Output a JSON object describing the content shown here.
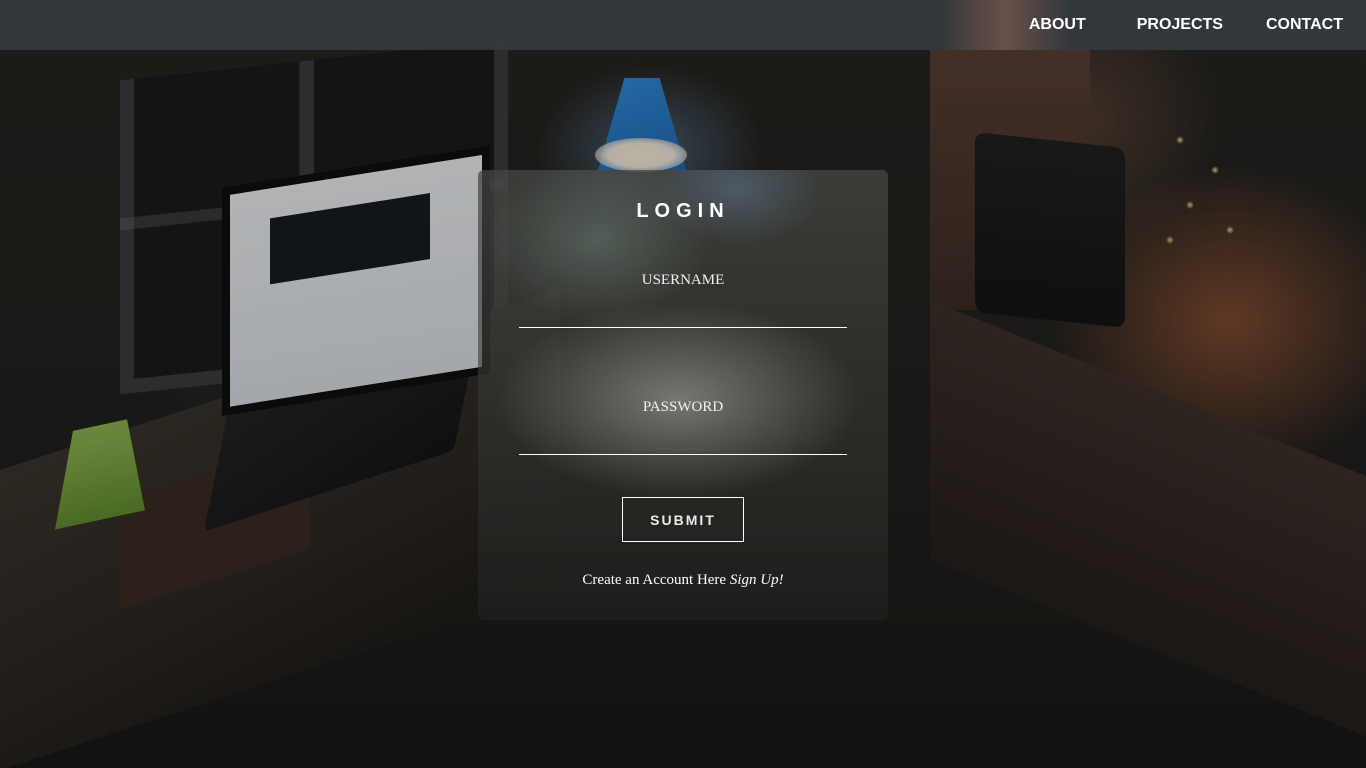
{
  "navbar": {
    "links": [
      {
        "label": "ABOUT"
      },
      {
        "label": "PROJECTS"
      },
      {
        "label": "CONTACT"
      }
    ],
    "background_color": "#343a3e",
    "text_color": "#ffffff"
  },
  "login": {
    "title": "LOGIN",
    "username_label": "USERNAME",
    "username_value": "",
    "password_label": "PASSWORD",
    "password_value": "",
    "submit_label": "SUBMIT",
    "signup_text": "Create an Account Here",
    "signup_link": "Sign Up!"
  },
  "background": {
    "description_icon": "dark-desk-photo",
    "accent_colors": [
      "#2f8fe0",
      "#d26e3c",
      "#a6d35a"
    ]
  }
}
